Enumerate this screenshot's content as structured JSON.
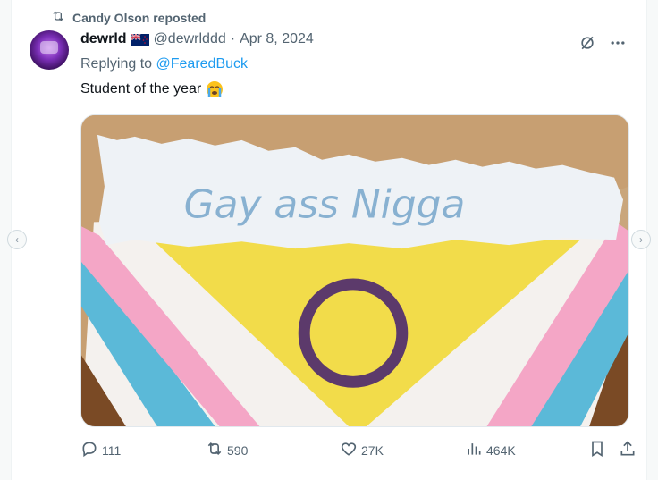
{
  "repost": {
    "text": "Candy Olson reposted",
    "icon": "repost-icon"
  },
  "tweet": {
    "display_name": "dewrld",
    "handle": "@dewrlddd",
    "separator": "·",
    "date": "Apr 8, 2024",
    "replying_prefix": "Replying to",
    "replying_to": "@FearedBuck",
    "text": "Student of the year",
    "emoji": "loudly-crying-face"
  },
  "media": {
    "banner_text": "Gay ass Nigga",
    "description_colors": {
      "paper": "#d4b48a",
      "blue": "#5bb9d8",
      "pink": "#f4a6c6",
      "white": "#f4f1ee",
      "yellow": "#f2dc4a",
      "brown": "#7a4a25",
      "ring": "#5c3a6b"
    }
  },
  "actions": {
    "replies": "111",
    "reposts": "590",
    "likes": "27K",
    "views": "464K"
  },
  "colors": {
    "link": "#1d9bf0",
    "secondary": "#536471",
    "text": "#0f1419"
  }
}
